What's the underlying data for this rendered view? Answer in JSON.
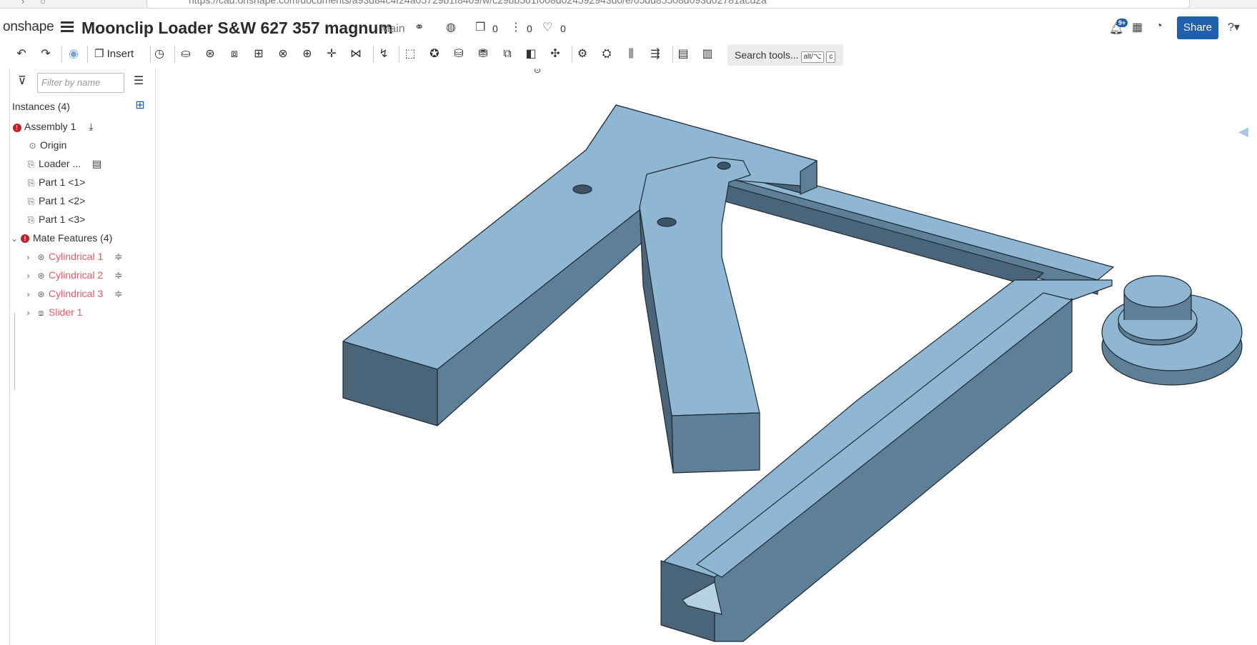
{
  "browser": {
    "url": "https://cad.onshape.com/documents/a93d84c4f24a05729b1f8409/w/c29bb561f008d024592943d0/e/05dd85508d093d02781acd2a"
  },
  "header": {
    "logo": "onshape",
    "document_title": "Moonclip Loader S&W 627 357 magnum",
    "branch": "Main",
    "versions_count": "0",
    "branches_count": "0",
    "likes_count": "0",
    "notifications_badge": "9+",
    "share_label": "Share"
  },
  "toolbar": {
    "insert_label": "Insert",
    "search_label": "Search tools...",
    "shortcut_key_1": "alt/⌥",
    "shortcut_key_2": "c"
  },
  "panel": {
    "filter_placeholder": "Filter by name",
    "instances_title": "Instances (4)",
    "instances": [
      {
        "label": "Assembly 1"
      },
      {
        "label": "Origin"
      },
      {
        "label": "Loader ..."
      },
      {
        "label": "Part 1 <1>"
      },
      {
        "label": "Part 1 <2>"
      },
      {
        "label": "Part 1 <3>"
      }
    ],
    "mate_features_title": "Mate Features (4)",
    "mates": [
      {
        "label": "Cylindrical 1"
      },
      {
        "label": "Cylindrical 2"
      },
      {
        "label": "Cylindrical 3"
      },
      {
        "label": "Slider 1"
      }
    ]
  },
  "colors": {
    "accent": "#1f5fb0",
    "part_top": "#8fb7d3",
    "part_side": "#5e7f98",
    "part_dark": "#4a6479",
    "mate_text": "#e05a6b",
    "error_red": "#c0202a"
  }
}
